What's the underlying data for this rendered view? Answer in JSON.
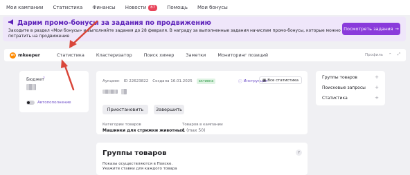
{
  "topnav": {
    "items": [
      "Мои кампании",
      "Статистика",
      "Финансы",
      "Новости",
      "Помощь",
      "Мои бонусы"
    ],
    "news_badge": "87"
  },
  "promo": {
    "title": "Дарим промо-бонусы за задания по продвижению",
    "text": "Заходите в раздел «Мои бонусы» и выполняйте задания до 28 февраля. В награду за выполненные задания начислим промо-бонусы, которые можно потратить на продвижение",
    "button": "Посмотреть задания"
  },
  "subnav": {
    "logo": "mkeeper",
    "tabs": [
      "Статистика",
      "Кластеризатор",
      "Поиск химер",
      "Заметки",
      "Мониторинг позиций"
    ],
    "profile": "Профиль"
  },
  "budget": {
    "label": "Бюджет",
    "help": "?",
    "autopay": "Автопополнение"
  },
  "campaign": {
    "type": "Аукцион",
    "id": "ID 22623822",
    "created": "Создана 16.01.2025",
    "status": "активна",
    "instruction": "Инструкция",
    "all_stats": "Все статистика",
    "pause": "Приостановить",
    "finish": "Завершить",
    "categories_label": "Категории товаров",
    "categories_value": "Машинки для стрижки животных",
    "goods_label": "Товаров в кампании",
    "goods_value": "1",
    "goods_max": "(max 50)"
  },
  "side": {
    "items": [
      "Группы товаров",
      "Поисковые запросы",
      "Статистика"
    ]
  },
  "groups": {
    "title": "Группы товаров",
    "text1": "Показы осуществляются в Поиске.",
    "text2": "Укажите ставки для каждого товара"
  },
  "colors": {
    "accent": "#8a3bdb",
    "promo_bg": "#efe6fa",
    "arrow": "#d9463a"
  }
}
